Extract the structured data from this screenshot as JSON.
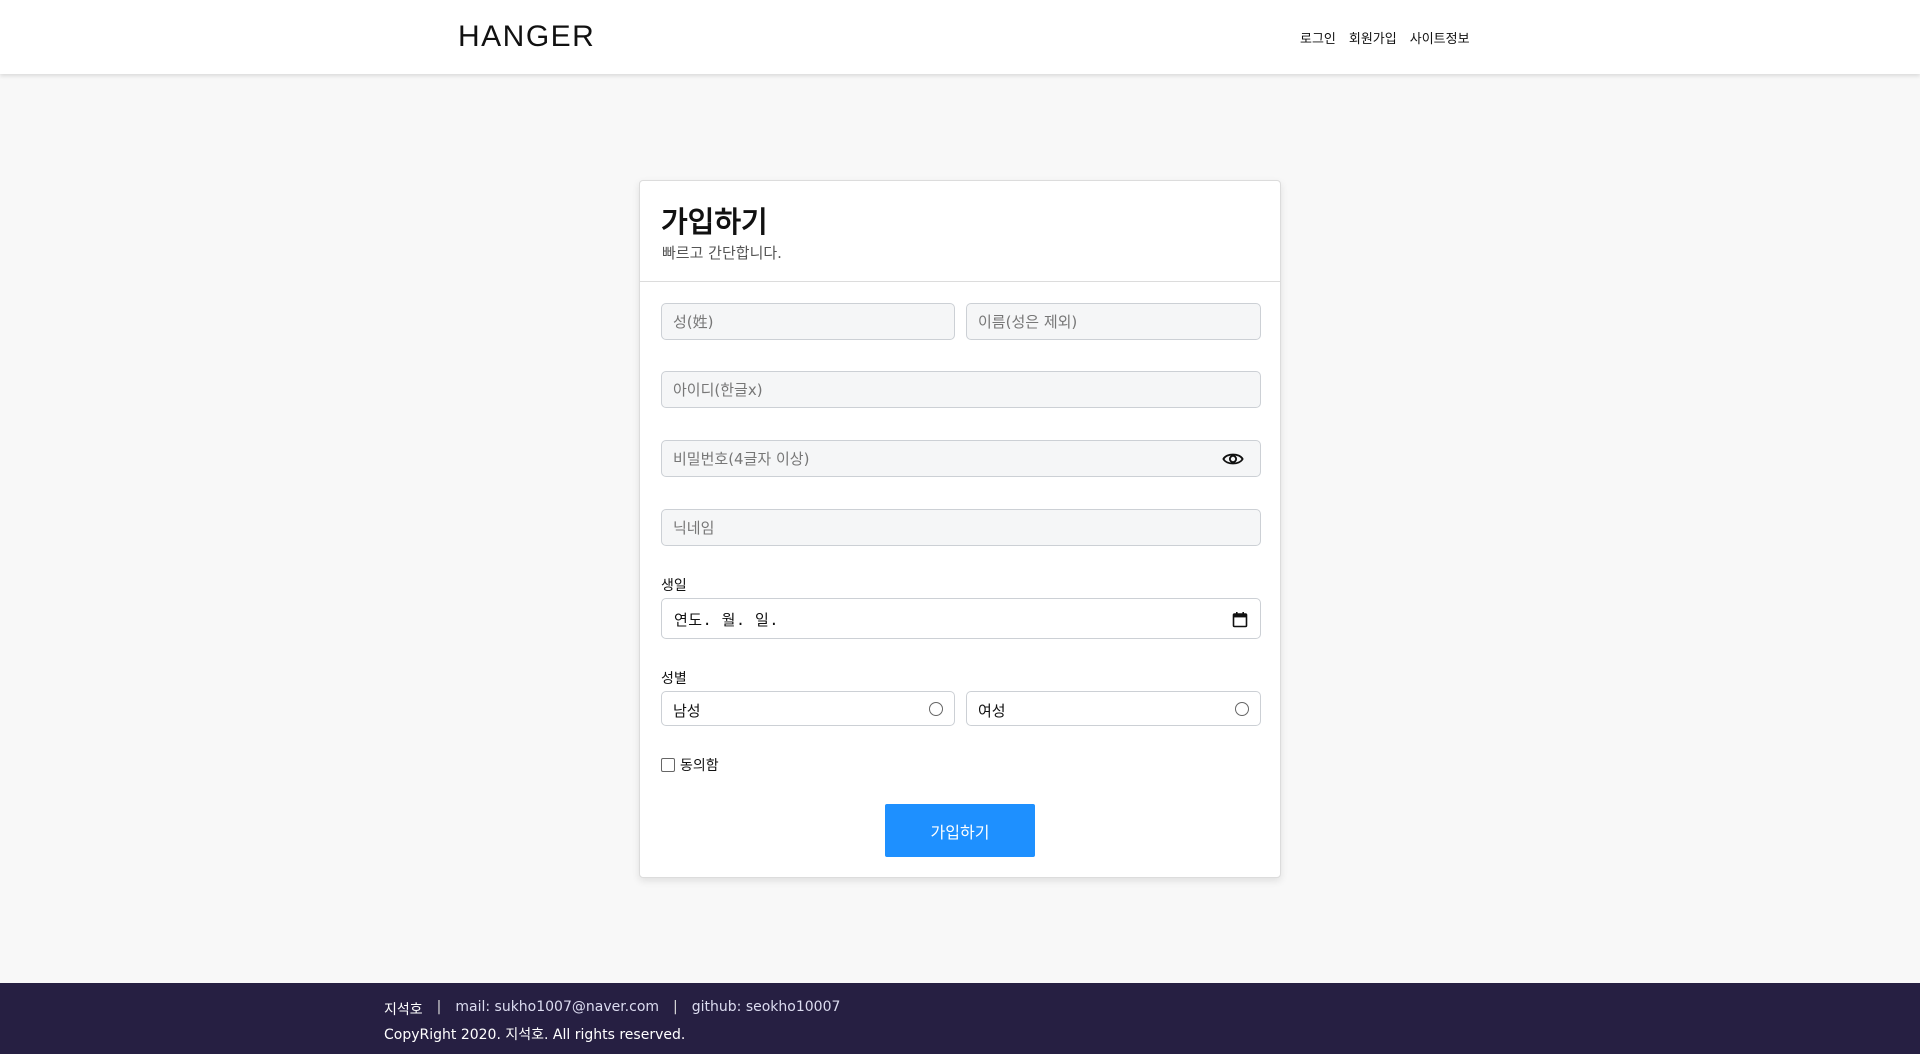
{
  "header": {
    "logo": "HANGER",
    "nav": [
      "로그인",
      "회원가입",
      "사이트정보"
    ]
  },
  "form": {
    "title": "가입하기",
    "subtitle": "빠르고 간단합니다.",
    "last_name_placeholder": "성(姓)",
    "first_name_placeholder": "이름(성은 제외)",
    "id_placeholder": "아이디(한글x)",
    "password_placeholder": "비밀번호(4글자 이상)",
    "nickname_placeholder": "닉네임",
    "birthday_label": "생일",
    "birthday_value": "연도. 월. 일.",
    "gender_label": "성별",
    "gender_male": "남성",
    "gender_female": "여성",
    "agree_label": "동의함",
    "submit_label": "가입하기"
  },
  "footer": {
    "name": "지석호",
    "separator": "|",
    "mail": "mail: sukho1007@naver.com",
    "github": "github: seokho10007",
    "copyright": "CopyRight 2020. 지석호. All rights reserved."
  },
  "colors": {
    "primary_button": "#1e90ff",
    "footer_bg": "#261f42",
    "page_bg": "#f8f8f8"
  }
}
